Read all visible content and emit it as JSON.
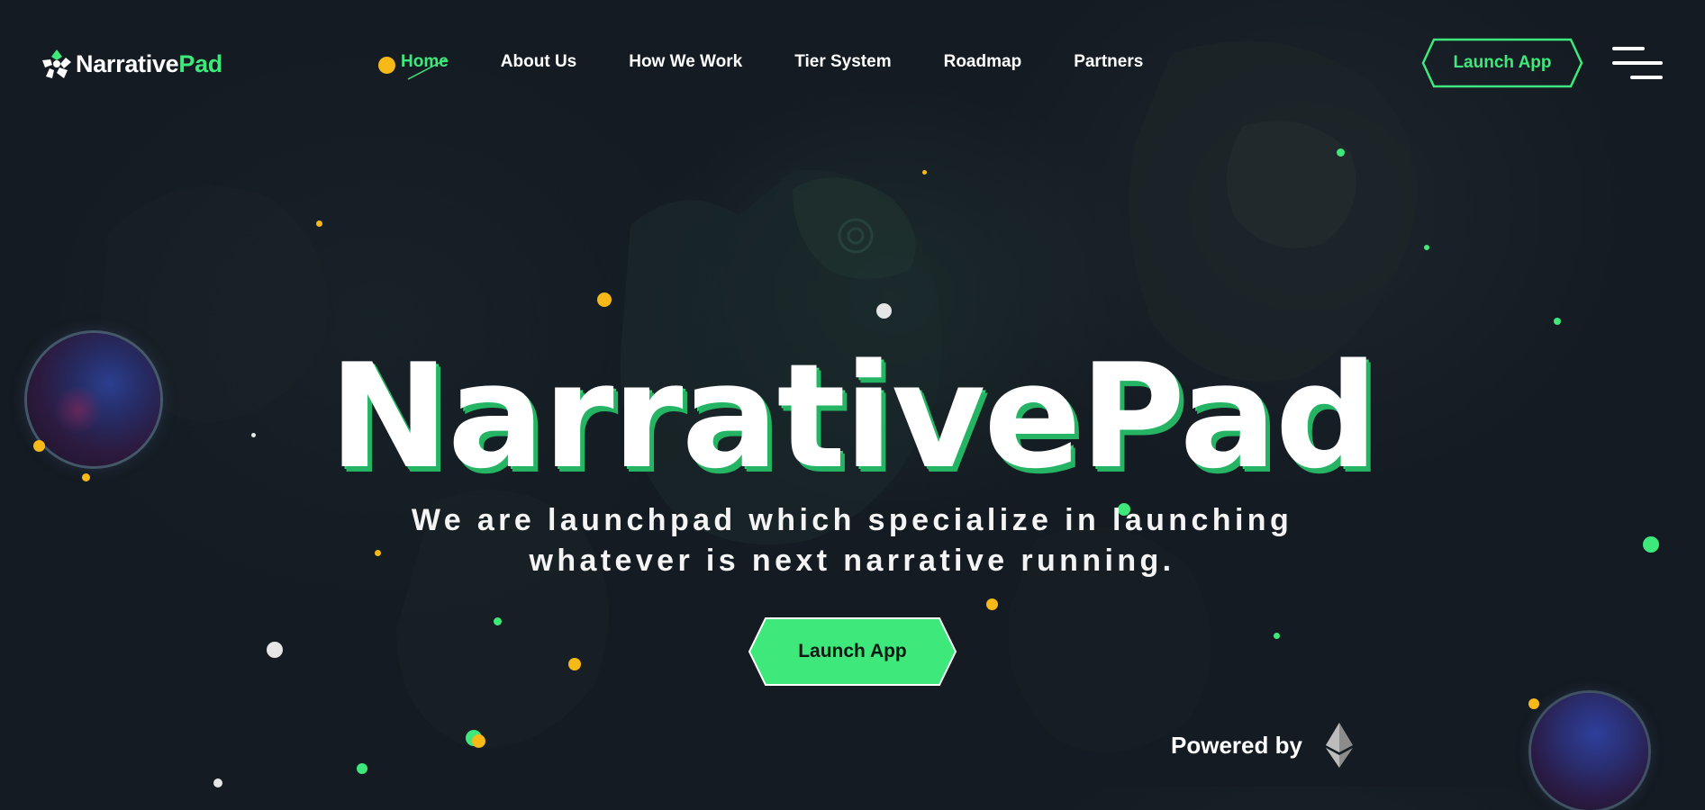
{
  "brand": {
    "name_part1": "Narrative",
    "name_part2": "Pad",
    "accent_color": "#3ee87a",
    "dot_color": "#f7b918"
  },
  "nav": {
    "items": [
      {
        "label": "Home",
        "active": true
      },
      {
        "label": "About Us"
      },
      {
        "label": "How We Work"
      },
      {
        "label": "Tier System"
      },
      {
        "label": "Roadmap"
      },
      {
        "label": "Partners"
      }
    ]
  },
  "header": {
    "launch_label": "Launch App",
    "menu_icon": "hamburger-menu-icon"
  },
  "hero": {
    "title": "NarrativePad",
    "subtitle_line1": "We are launchpad which specialize in launching",
    "subtitle_line2": "whatever is next narrative running.",
    "launch_label": "Launch App"
  },
  "footer": {
    "powered_by": "Powered by",
    "powered_icon": "ethereum-icon"
  }
}
